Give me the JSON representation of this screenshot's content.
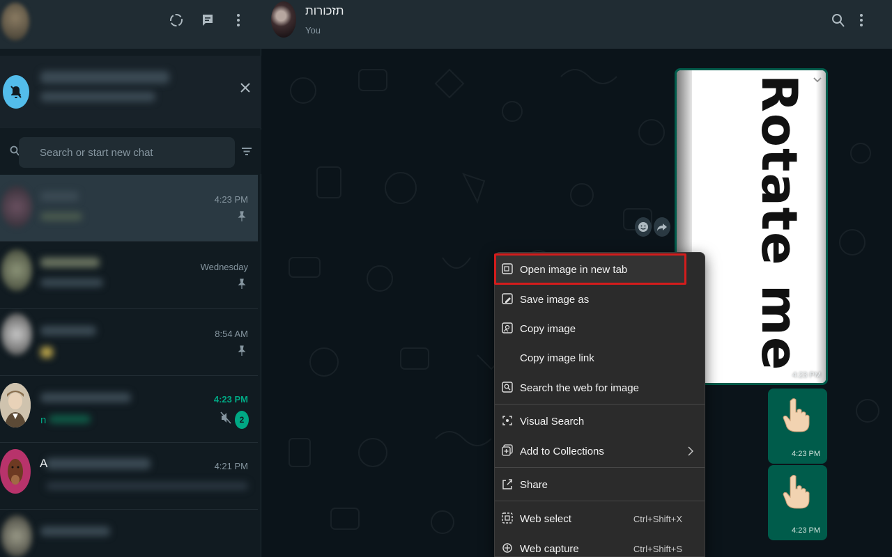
{
  "sidebar": {
    "search": {
      "placeholder": "Search or start new chat"
    },
    "chats": [
      {
        "time": "4:23 PM",
        "pinned": true,
        "active": true
      },
      {
        "time": "Wednesday",
        "pinned": true
      },
      {
        "time": "8:54 AM",
        "pinned": true
      },
      {
        "time": "4:23 PM",
        "unread": "2",
        "muted": true,
        "preview": "n"
      },
      {
        "time": "4:21 PM",
        "sender_initial": "A"
      }
    ]
  },
  "conversation": {
    "title": "תזכורות",
    "subtitle": "You",
    "image_message": {
      "text": "Rotate me",
      "time": "4:23 PM"
    },
    "hand_messages": [
      {
        "time": "4:23 PM"
      },
      {
        "time": "4:23 PM"
      }
    ]
  },
  "context_menu": {
    "items": [
      {
        "label": "Open image in new tab",
        "icon": "new-tab-icon",
        "highlighted": true
      },
      {
        "label": "Save image as",
        "icon": "save-icon"
      },
      {
        "label": "Copy image",
        "icon": "copy-image-icon"
      },
      {
        "label": "Copy image link"
      },
      {
        "label": "Search the web for image",
        "icon": "search-web-icon"
      },
      {
        "label": "Visual Search",
        "icon": "visual-search-icon"
      },
      {
        "label": "Add to Collections",
        "icon": "collections-icon",
        "has_submenu": true
      },
      {
        "label": "Share",
        "icon": "share-icon"
      },
      {
        "label": "Web select",
        "icon": "web-select-icon",
        "shortcut": "Ctrl+Shift+X"
      },
      {
        "label": "Web capture",
        "icon": "web-capture-icon",
        "shortcut": "Ctrl+Shift+S"
      }
    ]
  },
  "colors": {
    "accent": "#00a884",
    "highlight_border": "#d31c1c",
    "bubble_out": "#005c4b"
  }
}
